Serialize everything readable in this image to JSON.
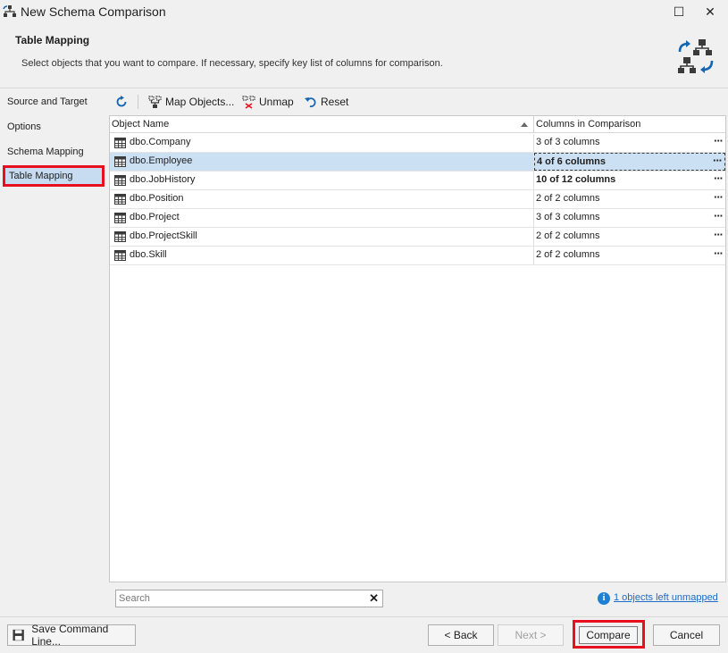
{
  "window": {
    "title": "New Schema Comparison",
    "controls": {
      "minimize": "—",
      "maximize": "☐",
      "close": "✕"
    }
  },
  "header": {
    "title": "Table Mapping",
    "description": "Select objects that you want to compare. If necessary, specify key list of columns for comparison.",
    "icon": "schema-sync-icon"
  },
  "sidebar": {
    "items": [
      {
        "label": "Source and Target",
        "active": false
      },
      {
        "label": "Options",
        "active": false
      },
      {
        "label": "Schema Mapping",
        "active": false
      },
      {
        "label": "Table Mapping",
        "active": true
      }
    ]
  },
  "toolbar": {
    "refresh_icon": "refresh-icon",
    "map_objects_label": "Map Objects...",
    "unmap_label": "Unmap",
    "reset_label": "Reset"
  },
  "grid": {
    "columns": [
      "Object Name",
      "Columns in Comparison"
    ],
    "sort_indicator": "ascending",
    "rows": [
      {
        "name": "dbo.Company",
        "columns": "3 of 3 columns",
        "bold": false,
        "selected": false
      },
      {
        "name": "dbo.Employee",
        "columns": "4 of 6 columns",
        "bold": true,
        "selected": true
      },
      {
        "name": "dbo.JobHistory",
        "columns": "10 of 12 columns",
        "bold": true,
        "selected": false
      },
      {
        "name": "dbo.Position",
        "columns": "2 of 2 columns",
        "bold": false,
        "selected": false
      },
      {
        "name": "dbo.Project",
        "columns": "3 of 3 columns",
        "bold": false,
        "selected": false
      },
      {
        "name": "dbo.ProjectSkill",
        "columns": "2 of 2 columns",
        "bold": false,
        "selected": false
      },
      {
        "name": "dbo.Skill",
        "columns": "2 of 2 columns",
        "bold": false,
        "selected": false
      }
    ],
    "more_label": "···"
  },
  "search": {
    "value": "",
    "placeholder": "Search",
    "clear_glyph": "✕"
  },
  "status": {
    "info_glyph": "i",
    "unmapped_text": "1 objects left unmapped"
  },
  "footer": {
    "save_label": "Save Command Line...",
    "back_label": "< Back",
    "next_label": "Next >",
    "compare_label": "Compare",
    "cancel_label": "Cancel"
  },
  "colors": {
    "highlight": "#e8101e",
    "selection": "#cce0f4",
    "accent": "#1e6bc6",
    "icon_blue": "#1565b0",
    "icon_dark": "#3a3a3a"
  }
}
